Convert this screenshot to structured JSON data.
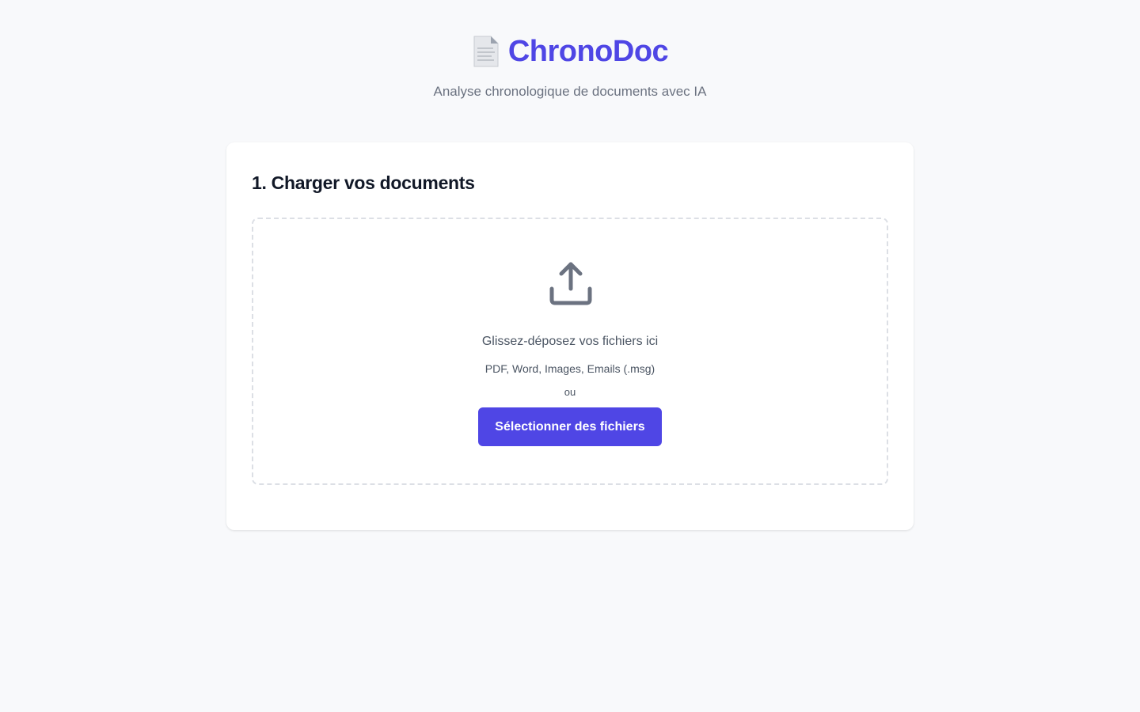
{
  "header": {
    "title": "ChronoDoc",
    "subtitle": "Analyse chronologique de documents avec IA",
    "icon": "document-icon"
  },
  "upload_section": {
    "title": "1. Charger vos documents",
    "dropzone": {
      "icon": "upload-icon",
      "instruction": "Glissez-déposez vos fichiers ici",
      "formats": "PDF, Word, Images, Emails (.msg)",
      "separator": "ou",
      "button_label": "Sélectionner des fichiers"
    }
  },
  "colors": {
    "accent": "#4f46e5",
    "background": "#f8f9fb",
    "text_muted": "#6b7280"
  }
}
